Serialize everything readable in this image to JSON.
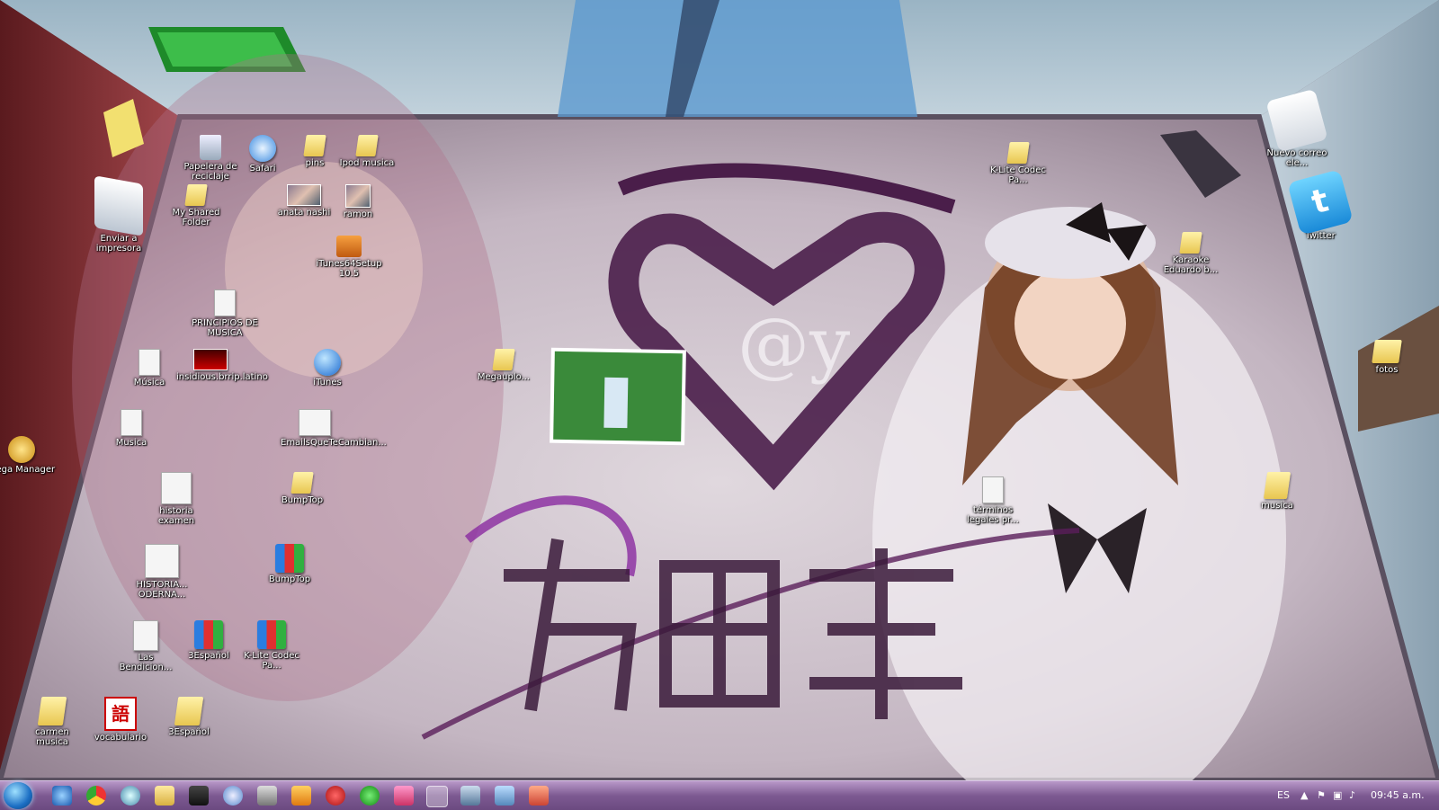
{
  "desktop": {
    "icons": [
      {
        "id": "recycle-bin",
        "label": "Papelera de reciclaje",
        "kind": "bin"
      },
      {
        "id": "safari",
        "label": "Safari",
        "kind": "compass"
      },
      {
        "id": "pins",
        "label": "pins",
        "kind": "folder"
      },
      {
        "id": "ipod-musica",
        "label": "Ipod musica",
        "kind": "folder"
      },
      {
        "id": "my-shared-folder",
        "label": "My Shared Folder",
        "kind": "folder"
      },
      {
        "id": "anata-nashi",
        "label": "anata nashi",
        "kind": "thumb"
      },
      {
        "id": "ramon",
        "label": "ramon",
        "kind": "thumb"
      },
      {
        "id": "itunes-setup",
        "label": "iTunes64Setup 10.5",
        "kind": "package"
      },
      {
        "id": "principios-musica",
        "label": "PRINCIPIOS DE MUSICA",
        "kind": "doc"
      },
      {
        "id": "musica-1",
        "label": "Música",
        "kind": "doc"
      },
      {
        "id": "insidious",
        "label": "insidious.brrip.latino",
        "kind": "thumb"
      },
      {
        "id": "itunes",
        "label": "iTunes",
        "kind": "itunes"
      },
      {
        "id": "musica-2",
        "label": "Musica",
        "kind": "doc"
      },
      {
        "id": "emails",
        "label": "EmailsQueTeCambian...",
        "kind": "doc"
      },
      {
        "id": "historia-examen",
        "label": "historia examen",
        "kind": "doc"
      },
      {
        "id": "bumptop-folder",
        "label": "BumpTop",
        "kind": "folder"
      },
      {
        "id": "historia-moderna",
        "label": "HISTORIA... ODERNA...",
        "kind": "doc"
      },
      {
        "id": "bumptop-rar",
        "label": "BumpTop",
        "kind": "rar"
      },
      {
        "id": "las-bendiciones",
        "label": "Las Bendicion...",
        "kind": "doc"
      },
      {
        "id": "3espanol-rar",
        "label": "3Español",
        "kind": "rar"
      },
      {
        "id": "klite-rar",
        "label": "K-Lite Codec Pa...",
        "kind": "rar"
      },
      {
        "id": "carmen-musica",
        "label": "carmen musica",
        "kind": "folder"
      },
      {
        "id": "vocabulario",
        "label": "vocabulario",
        "kind": "vocab"
      },
      {
        "id": "3espanol-folder",
        "label": "3Español",
        "kind": "folder"
      },
      {
        "id": "megauplo",
        "label": "Megauplo...",
        "kind": "folder"
      },
      {
        "id": "klite-folder",
        "label": "K-Lite Codec Pa...",
        "kind": "folder"
      },
      {
        "id": "karaoke",
        "label": "Karaoke Eduardo b...",
        "kind": "folder"
      },
      {
        "id": "terminos",
        "label": "términos legales pr...",
        "kind": "doc"
      },
      {
        "id": "musica-folder",
        "label": "musica",
        "kind": "folder"
      },
      {
        "id": "enviar-impresora",
        "label": "Enviar a impresora",
        "kind": "printer"
      },
      {
        "id": "mega-manager",
        "label": "Mega Manager",
        "kind": "mega"
      },
      {
        "id": "nuevo-correo",
        "label": "Nuevo correo ele...",
        "kind": "mail"
      },
      {
        "id": "twitter",
        "label": "Twitter",
        "kind": "twitter"
      },
      {
        "id": "fotos",
        "label": "fotos",
        "kind": "folder"
      }
    ]
  },
  "taskbar": {
    "language": "ES",
    "clock": "09:45 a.m."
  },
  "colors": {
    "taskbar": "#7d5a92",
    "floor": "#c8bcc6",
    "accent_purple": "#4a1e4a"
  }
}
